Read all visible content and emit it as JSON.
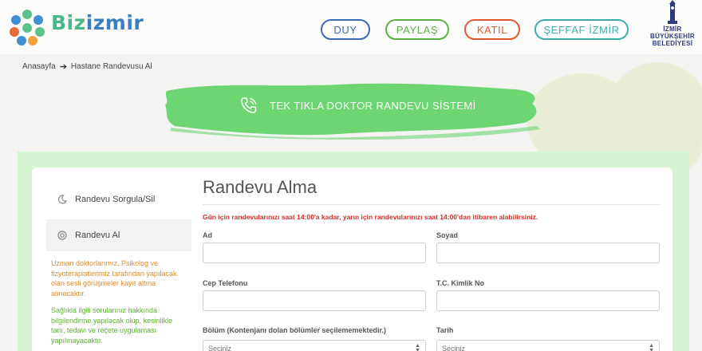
{
  "header": {
    "brand_part1": "Biz",
    "brand_part2": "izmir",
    "nav": [
      "DUY",
      "PAYLAŞ",
      "KATIL",
      "ŞEFFAF İZMİR"
    ],
    "municipality": [
      "İZMİR",
      "BÜYÜKŞEHİR",
      "BELEDİYESİ"
    ]
  },
  "breadcrumb": {
    "home": "Anasayfa",
    "current": "Hastane Randevusu Al"
  },
  "banner": {
    "title": "TEK TIKLA DOKTOR RANDEVU SİSTEMİ",
    "icon": "phone-icon"
  },
  "sidebar": {
    "items": [
      {
        "label": "Randevu Sorgula/Sil",
        "icon": "moon-icon",
        "active": false
      },
      {
        "label": "Randevu Al",
        "icon": "target-icon",
        "active": true
      }
    ],
    "notes": [
      "Uzman doktorlarımız, Psikolog ve fizyoterapistlerimiz tarafından yapılacak olan sesli görüşmeler kayıt altına alınacaktır.",
      "Sağlıkla ilgili sorularınız hakkında bilgilendirme yapılacak olup, kesinlikle tanı, tedavi ve reçete uygulaması yapılmayacaktır."
    ]
  },
  "form": {
    "title": "Randevu Alma",
    "warning": "Gün için randevularınızı saat 14:00'a kadar, yarın için randevularınızı saat 14:00'dan itibaren alabilirsiniz.",
    "fields": {
      "ad": {
        "label": "Ad",
        "value": ""
      },
      "soyad": {
        "label": "Soyad",
        "value": ""
      },
      "telefon": {
        "label": "Cep Telefonu",
        "value": ""
      },
      "tc": {
        "label": "T.C. Kimlik No",
        "value": ""
      },
      "bolum": {
        "label": "Bölüm (Kontenjanı dolan bölümler seçilememektedir.)",
        "selected": "Seçiniz"
      },
      "tarih": {
        "label": "Tarih",
        "selected": "Seçiniz"
      }
    }
  },
  "colors": {
    "duy": "#3b6bb5",
    "paylas": "#5bb146",
    "katil": "#e15a2d",
    "seffaf": "#3fb0a8",
    "banner_green": "#6dd673",
    "band_green": "#d5f5d2",
    "warning_red": "#d0312d"
  }
}
